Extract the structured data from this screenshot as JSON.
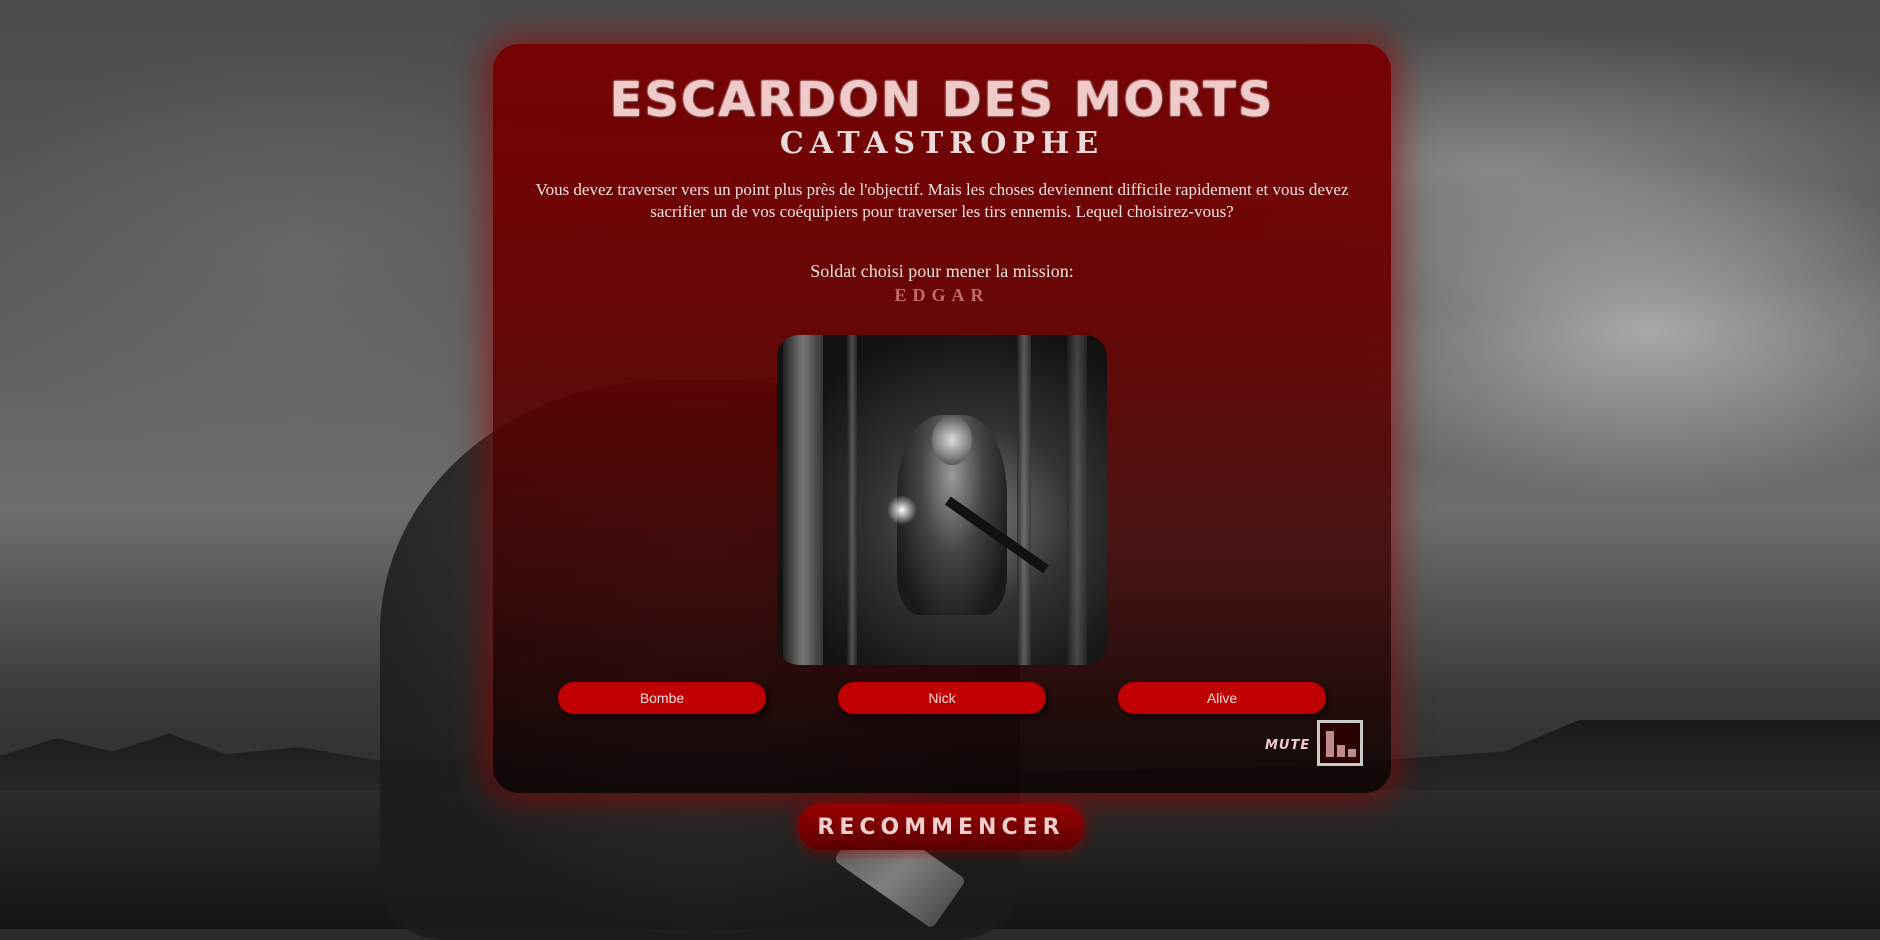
{
  "game": {
    "title": "ESCARDON DES MORTS",
    "subtitle": "CATASTROPHE",
    "story": "Vous devez traverser vers un point plus près de l'objectif. Mais les choses deviennent difficile rapidement et vous devez sacrifier un de vos coéquipiers pour traverser les tirs ennemis. Lequel choisirez-vous?",
    "chosen_label": "Soldat choisi pour mener la mission:",
    "chosen_name": "EDGAR"
  },
  "choices": [
    {
      "label": "Bombe"
    },
    {
      "label": "Nick"
    },
    {
      "label": "Alive"
    }
  ],
  "audio": {
    "mute_label": "MUTE",
    "icon": "volume-bars-icon"
  },
  "restart": {
    "label": "RECOMMENCER"
  },
  "colors": {
    "panel": "#780000",
    "button": "#c00000",
    "title_text": "#f0c9c9",
    "chosen_name": "#c46a6a"
  }
}
